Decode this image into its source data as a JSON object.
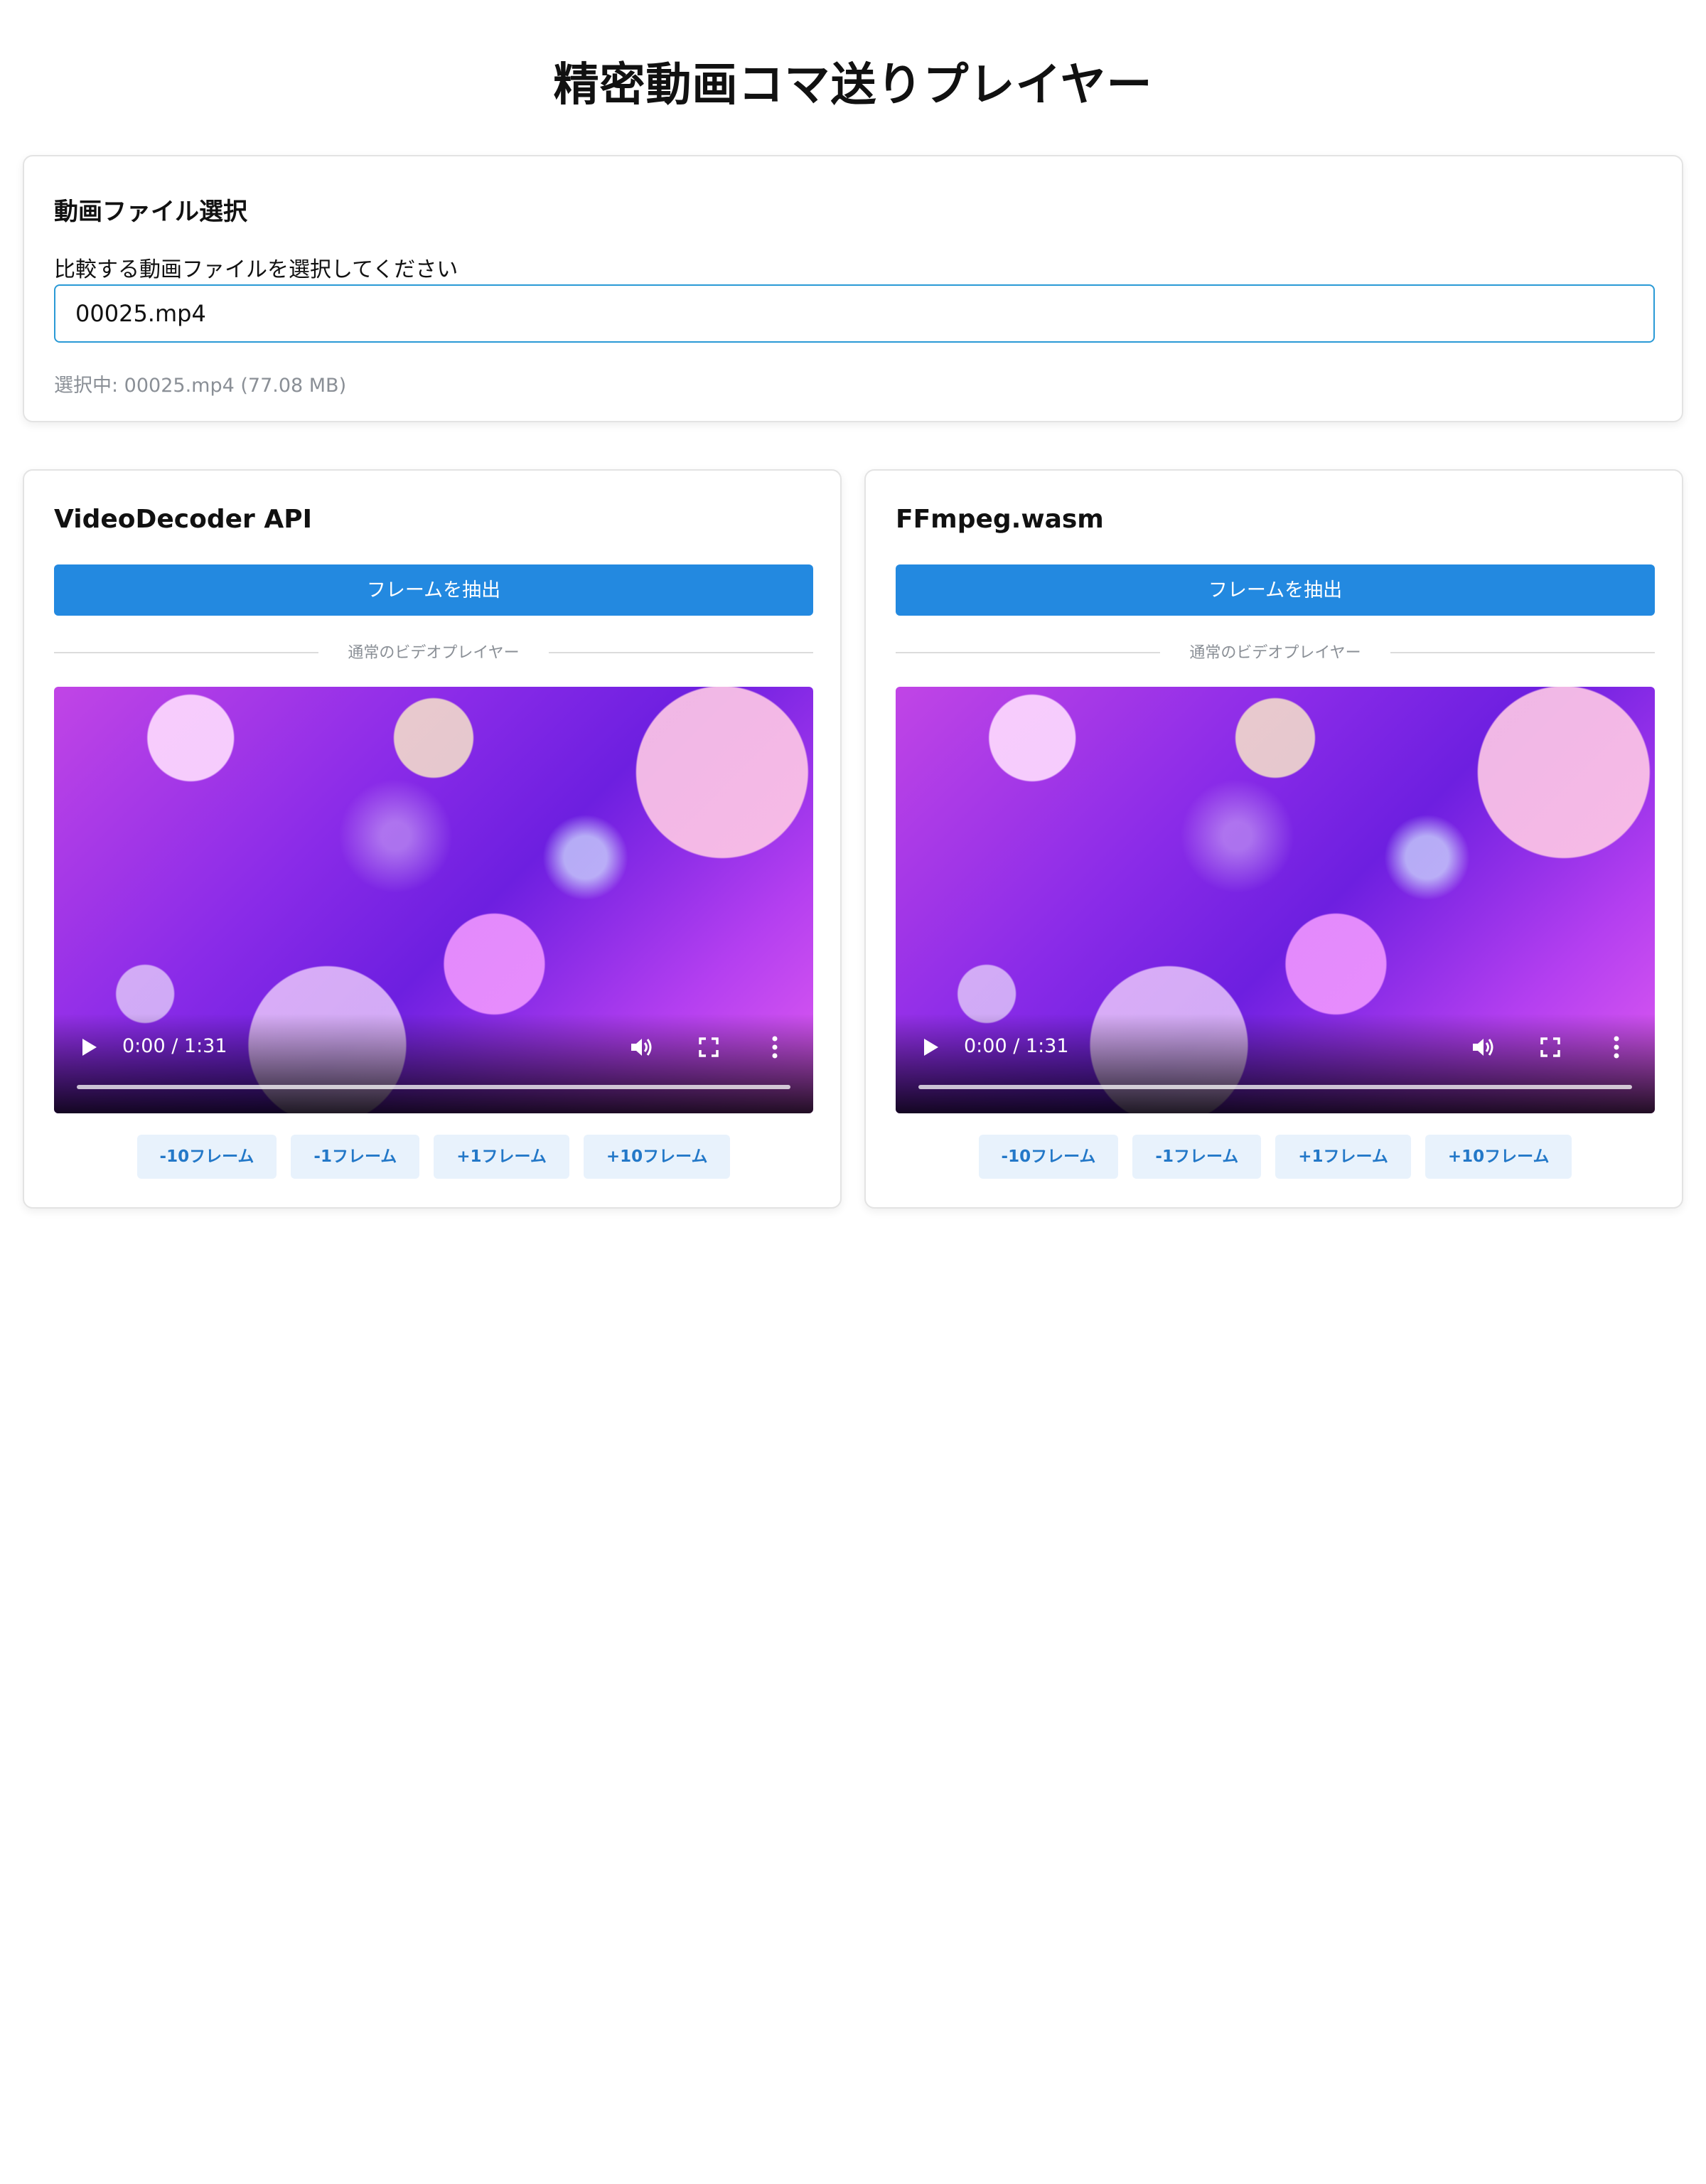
{
  "page": {
    "title": "精密動画コマ送りプレイヤー"
  },
  "file_select": {
    "heading": "動画ファイル選択",
    "label": "比較する動画ファイルを選択してください",
    "value": "00025.mp4",
    "selected_info": "選択中: 00025.mp4 (77.08 MB)"
  },
  "players": [
    {
      "title": "VideoDecoder API",
      "extract_label": "フレームを抽出",
      "divider_label": "通常のビデオプレイヤー",
      "time": "0:00 / 1:31",
      "steps": [
        "-10フレーム",
        "-1フレーム",
        "+1フレーム",
        "+10フレーム"
      ]
    },
    {
      "title": "FFmpeg.wasm",
      "extract_label": "フレームを抽出",
      "divider_label": "通常のビデオプレイヤー",
      "time": "0:00 / 1:31",
      "steps": [
        "-10フレーム",
        "-1フレーム",
        "+1フレーム",
        "+10フレーム"
      ]
    }
  ],
  "colors": {
    "primary": "#2389e0",
    "input_border": "#2a9ad6",
    "step_bg": "#e8f2fc",
    "step_text": "#2378c8",
    "muted": "#8a8f96"
  },
  "icons": [
    "play-icon",
    "volume-icon",
    "fullscreen-icon",
    "more-vertical-icon"
  ]
}
